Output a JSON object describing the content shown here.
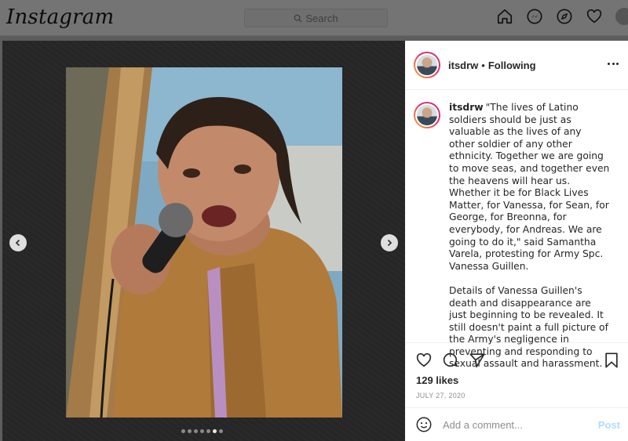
{
  "nav": {
    "logo": "Instagram",
    "search_placeholder": "Search",
    "icons": [
      "home-icon",
      "messenger-icon",
      "explore-icon",
      "heart-icon",
      "profile-avatar"
    ]
  },
  "media": {
    "slide_count": 7,
    "active_slide": 6,
    "prev_icon": "chevron-left-icon",
    "next_icon": "chevron-right-icon"
  },
  "post": {
    "username": "itsdrw",
    "separator": "•",
    "follow_status": "Following",
    "caption_paragraphs": [
      "\"The lives of Latino soldiers should be just as valuable as the lives of any other soldier of any other ethnicity. Together we are going to move seas, and together even the heavens will hear us. Whether it be for Black Lives Matter, for Vanessa, for Sean, for George, for Breonna, for everybody, for Andreas. We are going to do it,\" said Samantha Varela, protesting for Army Spc. Vanessa Guillen.",
      "Details of Vanessa Guillen's death and disappearance are just beginning to be revealed. It still doesn't paint a full picture of the Army's negligence in preventing and responding to sexual assault and harassment."
    ],
    "likes": "129 likes",
    "date": "JULY 27, 2020",
    "comment_placeholder": "Add a comment...",
    "post_label": "Post"
  },
  "colors": {
    "accent_disabled": "#b3dbff",
    "story_ring_start": "#f9b233",
    "story_ring_end": "#c13584",
    "muted_text": "#8e8e8e"
  }
}
